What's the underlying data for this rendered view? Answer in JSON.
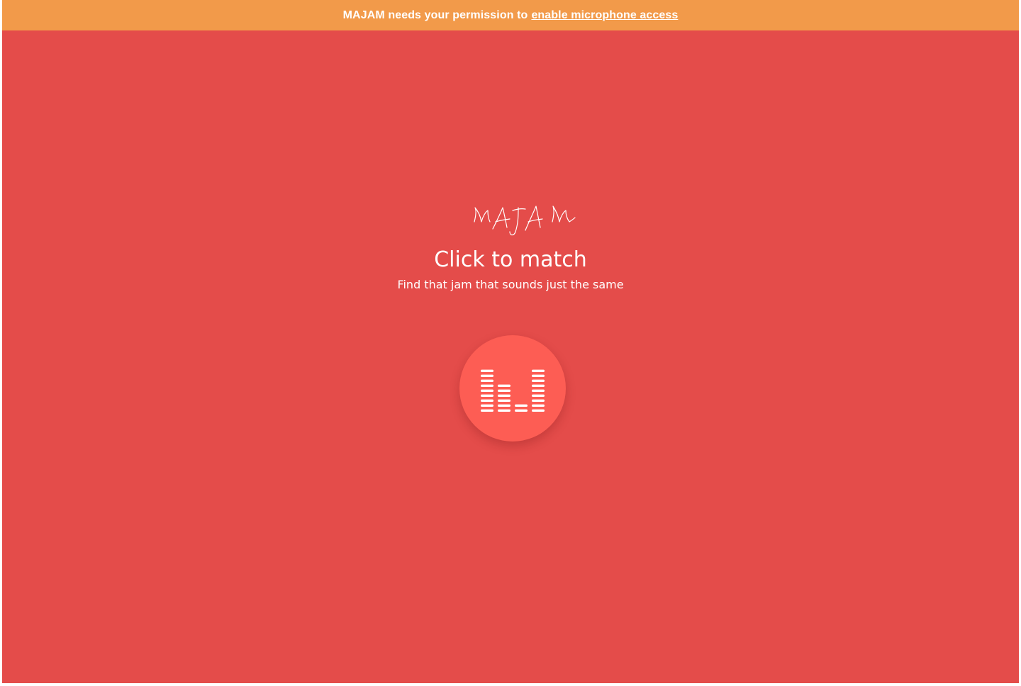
{
  "banner": {
    "text": "MAJAM needs your permission to",
    "link_label": "enable microphone access",
    "background": "#f29a4a"
  },
  "brand": {
    "logo_text": "MAJAM",
    "background": "#e44c4a",
    "button_color": "#fd5d54"
  },
  "main": {
    "headline": "Click to match",
    "subline": "Find that jam that sounds just the same"
  },
  "match_button": {
    "icon": "equalizer-icon",
    "bar_levels": [
      9,
      6,
      2,
      9
    ]
  }
}
